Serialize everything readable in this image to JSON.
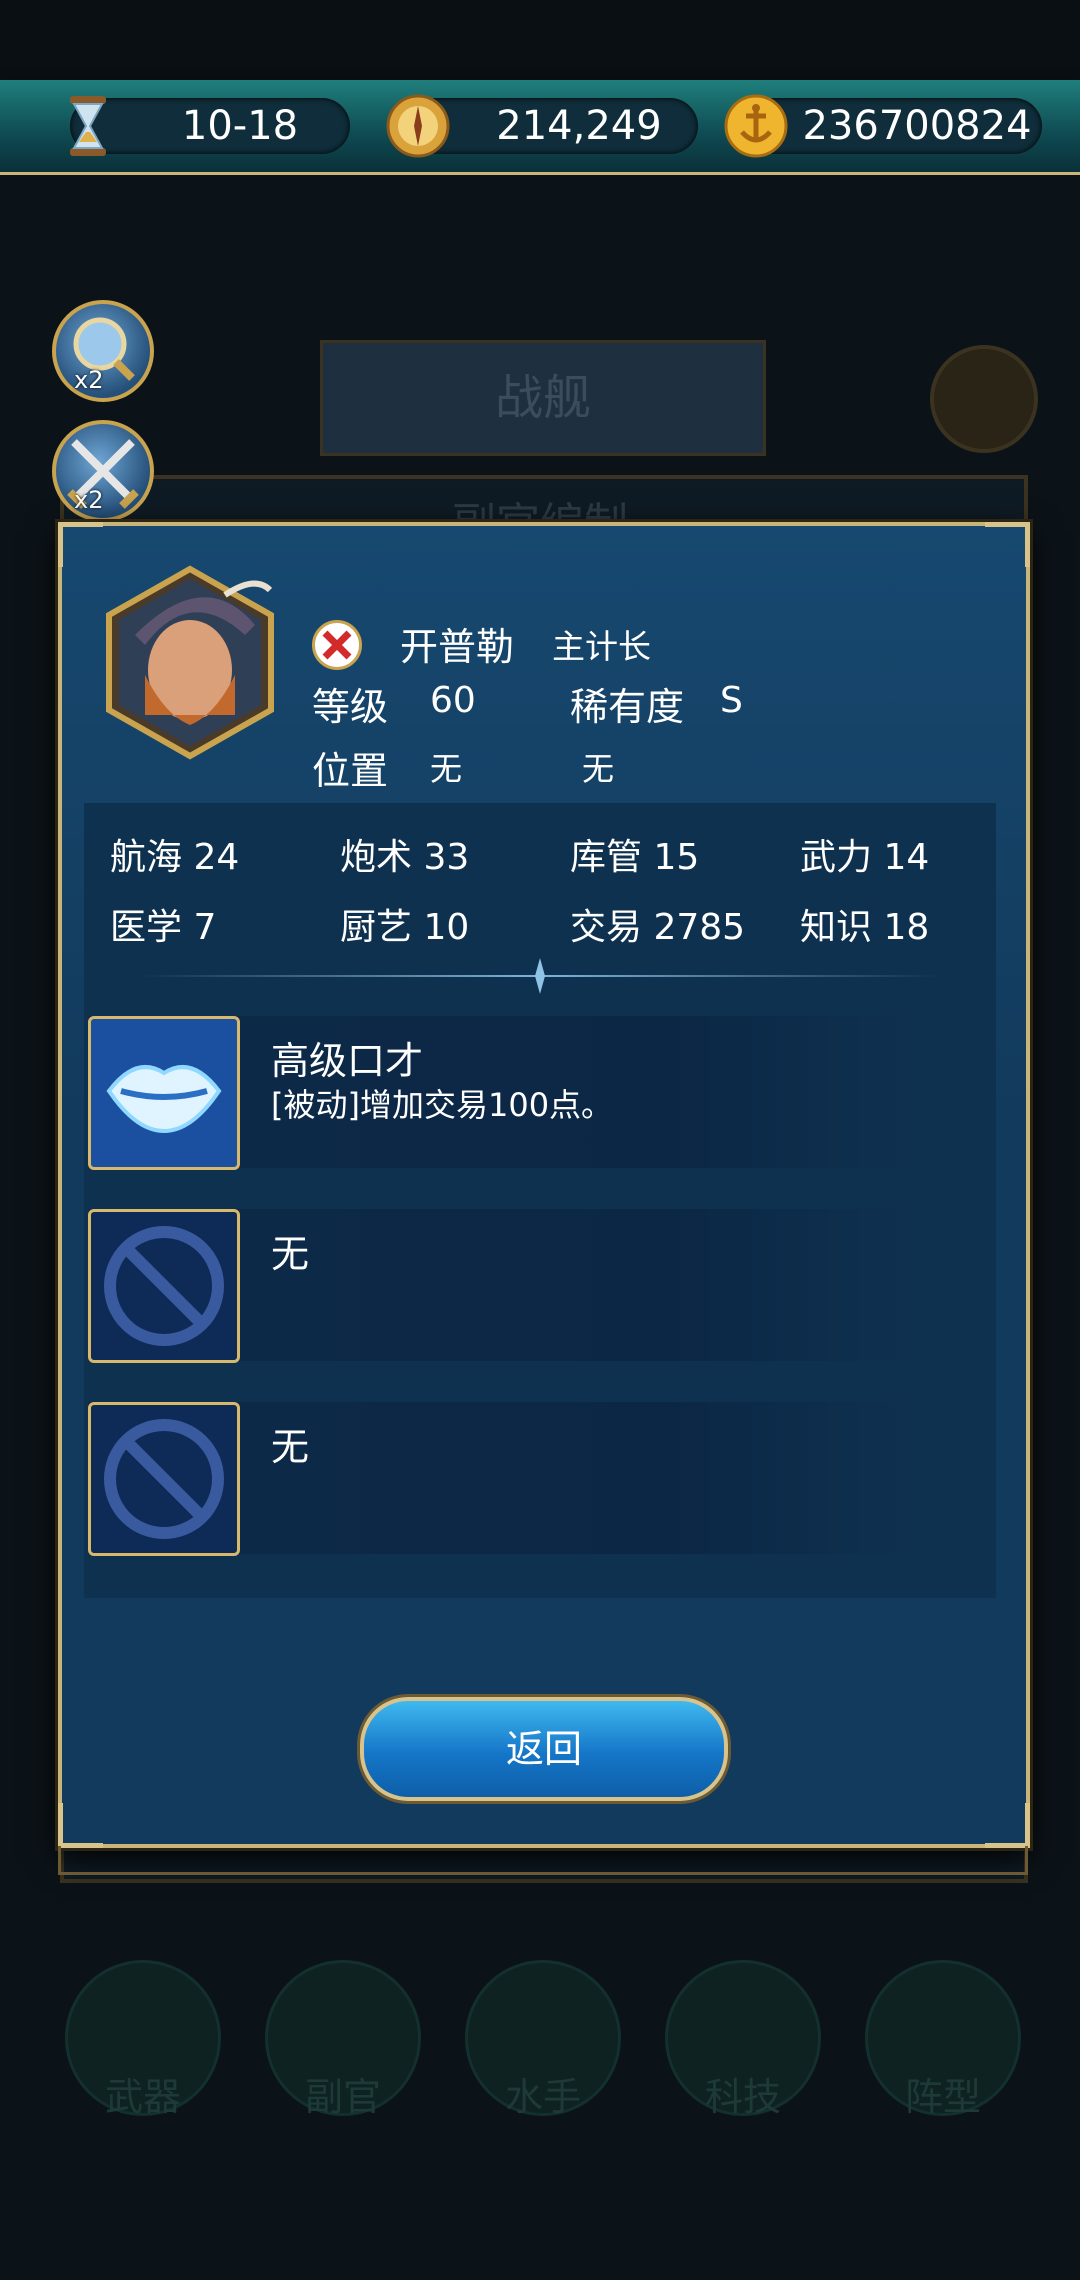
{
  "resources": [
    {
      "icon": "hourglass-icon",
      "value": "10-18"
    },
    {
      "icon": "compass-coin-icon",
      "value": "214,249"
    },
    {
      "icon": "anchor-coin-icon",
      "value": "236700824"
    }
  ],
  "background": {
    "banner_title": "战舰",
    "subpanel_title": "副官编制",
    "nav": [
      "武器",
      "副官",
      "水手",
      "科技",
      "阵型"
    ]
  },
  "side_buttons": [
    {
      "icon": "magnifier-icon",
      "badge": "x2"
    },
    {
      "icon": "crossed-swords-icon",
      "badge": "x2"
    }
  ],
  "officer": {
    "name": "开普勒",
    "title": "主计长",
    "level_label": "等级",
    "level": "60",
    "rarity_label": "稀有度",
    "rarity": "S",
    "position_label": "位置",
    "position_value1": "无",
    "position_value2": "无"
  },
  "stats": [
    {
      "label": "航海",
      "value": "24"
    },
    {
      "label": "炮术",
      "value": "33"
    },
    {
      "label": "库管",
      "value": "15"
    },
    {
      "label": "武力",
      "value": "14"
    },
    {
      "label": "医学",
      "value": "7"
    },
    {
      "label": "厨艺",
      "value": "10"
    },
    {
      "label": "交易",
      "value": "2785"
    },
    {
      "label": "知识",
      "value": "18"
    }
  ],
  "skills": [
    {
      "icon": "lips-icon",
      "name": "高级口才",
      "desc": "[被动]增加交易100点。"
    },
    {
      "icon": "no-entry-icon",
      "name": "无",
      "desc": ""
    },
    {
      "icon": "no-entry-icon",
      "name": "无",
      "desc": ""
    }
  ],
  "return_label": "返回",
  "colors": {
    "gold": "#c9b47a",
    "panel": "#123a5c",
    "button": "#1f8fd8"
  }
}
